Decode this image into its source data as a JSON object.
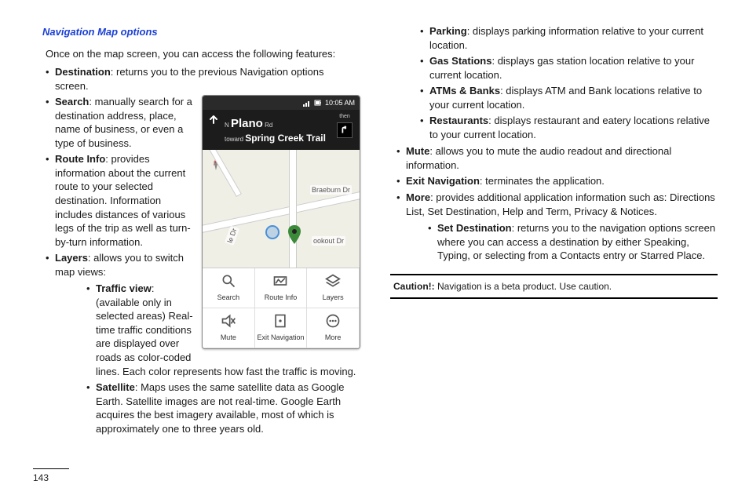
{
  "pageNumber": "143",
  "sectionTitle": "Navigation Map options",
  "intro": "Once on the map screen, you can access the following features:",
  "leftTop": {
    "destination": {
      "label": "Destination",
      "text": ": returns you to the previous Navigation options screen."
    },
    "search": {
      "label": "Search",
      "text": ": manually search for a destination address, place, name of business, or even a type of business."
    },
    "routeInfo": {
      "label": "Route Info",
      "text": ": provides information about the current route to your selected destination. Information includes distances of various legs of the trip as well as turn-by-turn information."
    },
    "layers": {
      "label": "Layers",
      "text": ": allows you to switch map views:"
    }
  },
  "layersSub": {
    "traffic": {
      "label": "Traffic view",
      "text": ": (available only in selected areas) Real-time traffic conditions are displayed over roads as color-coded lines. Each color represents how fast the traffic is moving."
    },
    "satellite": {
      "label": "Satellite",
      "text": ": Maps uses the same satellite data as Google Earth. Satellite images are not real-time. Google Earth acquires the best imagery available, most of which is approximately one to three years old."
    }
  },
  "rightSub": {
    "parking": {
      "label": "Parking",
      "text": ": displays parking information relative to your current location."
    },
    "gas": {
      "label": "Gas Stations",
      "text": ": displays gas station location relative to your current location."
    },
    "atms": {
      "label": "ATMs & Banks",
      "text": ": displays ATM and Bank locations relative to your current location."
    },
    "restaurants": {
      "label": "Restaurants",
      "text": ": displays restaurant and eatery locations relative to your current location."
    }
  },
  "rightMain": {
    "mute": {
      "label": "Mute",
      "text": ": allows you to mute the audio readout and directional information."
    },
    "exit": {
      "label": "Exit Navigation",
      "text": ": terminates the application."
    },
    "more": {
      "label": "More",
      "text": ": provides additional application information such as: Directions List, Set Destination, Help and Term, Privacy & Notices."
    }
  },
  "moreSub": {
    "setDest": {
      "label": "Set Destination",
      "text": ": returns you to the navigation options screen where you can access a destination by either Speaking, Typing, or selecting from a Contacts entry or Starred Place."
    }
  },
  "caution": {
    "label": "Caution!:",
    "text": " Navigation is a beta product. Use caution."
  },
  "phone": {
    "time": "10:05 AM",
    "nPrefix": "N ",
    "street": "Plano",
    "streetSuffix": " Rd",
    "towardPrefix": "toward ",
    "toward": "Spring Creek Trail",
    "then": "then",
    "road1": "Braeburn Dr",
    "road2": "ookout Dr",
    "road3": "le Dr",
    "menu": {
      "search": "Search",
      "route": "Route Info",
      "layers": "Layers",
      "mute": "Mute",
      "exit": "Exit Navigation",
      "more": "More"
    }
  }
}
